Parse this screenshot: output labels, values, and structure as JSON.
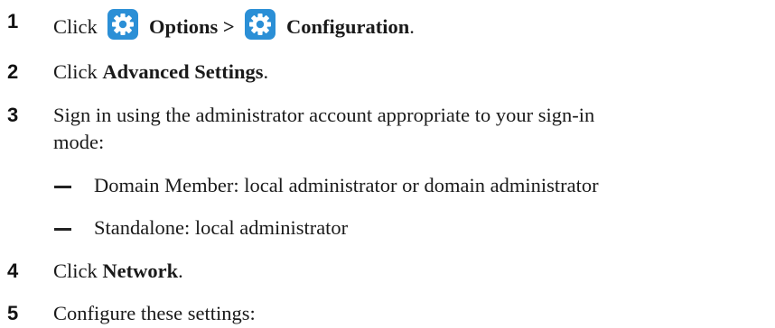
{
  "steps": [
    {
      "num": "1",
      "pre": "Click",
      "options_icon": "gear-icon",
      "options_label": "Options >",
      "config_icon": "gear-icon",
      "config_label": "Configuration",
      "post": "."
    },
    {
      "num": "2",
      "pre": "Click ",
      "bold": "Advanced Settings",
      "post": "."
    },
    {
      "num": "3",
      "line1": "Sign in using the administrator account appropriate to your sign-in",
      "line2": "mode:"
    },
    {
      "num": "4",
      "pre": "Click ",
      "bold": "Network",
      "post": "."
    },
    {
      "num": "5",
      "text": "Configure these settings:"
    }
  ],
  "substeps": [
    "Domain Member: local administrator or domain administrator",
    "Standalone: local administrator"
  ],
  "colors": {
    "icon_bg": "#2b8fd6",
    "icon_fg": "#ffffff",
    "text": "#1a1a1a"
  }
}
